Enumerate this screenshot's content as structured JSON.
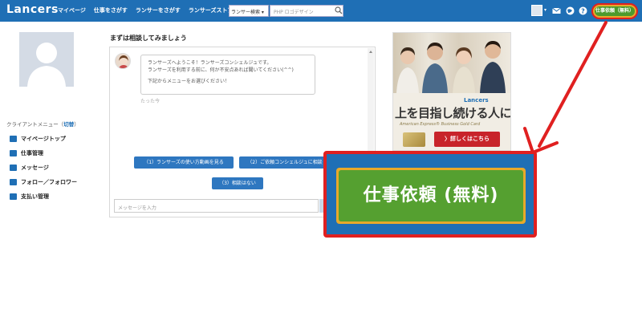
{
  "header": {
    "logo": "Lancers",
    "nav": [
      "マイページ",
      "仕事をさがす",
      "ランサーをさがす",
      "ランサーズストア"
    ],
    "search_select": "ランサー検索 ▾",
    "search_placeholder": "PHP ロゴデザイン",
    "cta": "仕事依頼（無料）"
  },
  "sidebar": {
    "menu_title_prefix": "クライアントメニュー（",
    "menu_title_link": "切替",
    "menu_title_suffix": "）",
    "items": [
      "マイページトップ",
      "仕事管理",
      "メッセージ",
      "フォロー／フォロワー",
      "支払い管理"
    ]
  },
  "chat": {
    "title": "まずは相談してみましょう",
    "message_lines": [
      "ランサーズへようこそ！ランサーズコンシェルジュです。",
      "ランサーズを利用する前に、何か不安点あれば聞いてください(^^)",
      "下記からメニューをお選びください！"
    ],
    "time": "たった今",
    "options": [
      "（1）ランサーズの使い方動画を見る",
      "（2）ご依頼コンシェルジュに相談",
      "（3）相談はない"
    ],
    "input_placeholder": "メッセージを入力"
  },
  "ad": {
    "brand": "Lancers",
    "headline": "上を目指し続ける人に。",
    "sub": "American Express® Business Gold Card",
    "button": "〉詳しくはこちら"
  },
  "zoom": {
    "label": "仕事依頼 (無料)"
  },
  "colors": {
    "header": "#1f6fb5",
    "cta_green": "#4d9a2c",
    "highlight_red": "#e02020",
    "option_blue": "#2e77c0"
  }
}
